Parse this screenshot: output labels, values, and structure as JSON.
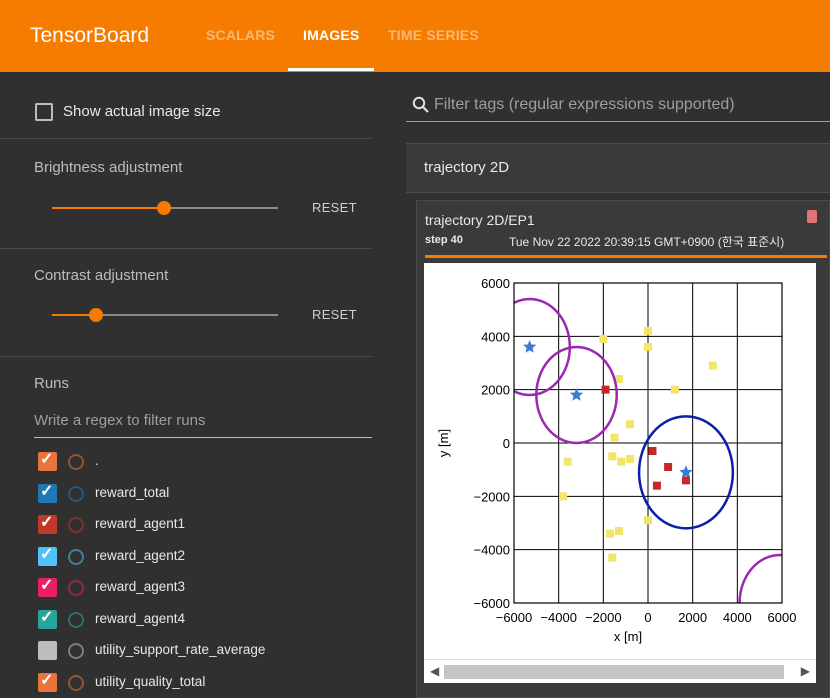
{
  "header": {
    "brand": "TensorBoard",
    "tabs": [
      {
        "label": "SCALARS",
        "active": false
      },
      {
        "label": "IMAGES",
        "active": true
      },
      {
        "label": "TIME SERIES",
        "active": false
      }
    ],
    "color": "#f57c00"
  },
  "sidebar": {
    "show_actual_size": {
      "label": "Show actual image size",
      "checked": false
    },
    "brightness": {
      "title": "Brightness adjustment",
      "reset_label": "RESET",
      "value": 0.5
    },
    "contrast": {
      "title": "Contrast adjustment",
      "reset_label": "RESET",
      "value": 0.2
    },
    "runs": {
      "title": "Runs",
      "filter_placeholder": "Write a regex to filter runs",
      "items": [
        {
          "label": ".",
          "checked": true,
          "color": "#e8743b"
        },
        {
          "label": "reward_total",
          "checked": true,
          "color": "#1f77b4"
        },
        {
          "label": "reward_agent1",
          "checked": true,
          "color": "#c0392b"
        },
        {
          "label": "reward_agent2",
          "checked": true,
          "color": "#4fc3f7"
        },
        {
          "label": "reward_agent3",
          "checked": true,
          "color": "#e91e63"
        },
        {
          "label": "reward_agent4",
          "checked": true,
          "color": "#26a69a"
        },
        {
          "label": "utility_support_rate_average",
          "checked": false,
          "color": "#bdbdbd"
        },
        {
          "label": "utility_quality_total",
          "checked": true,
          "color": "#e8743b"
        }
      ]
    }
  },
  "main": {
    "filter_placeholder": "Filter tags (regular expressions supported)",
    "group_title": "trajectory 2D",
    "card": {
      "title": "trajectory 2D/EP1",
      "step": "step 40",
      "timestamp": "Tue Nov 22 2022 20:39:15 GMT+0900 (한국 표준시)"
    }
  },
  "chart_data": {
    "type": "scatter",
    "xlabel": "x [m]",
    "ylabel": "y [m]",
    "xlim": [
      -6000,
      6000
    ],
    "ylim": [
      -6000,
      6000
    ],
    "x_ticks": [
      "−6000",
      "−4000",
      "−2000",
      "0",
      "2000",
      "4000",
      "6000"
    ],
    "y_ticks": [
      "6000",
      "4000",
      "2000",
      "0",
      "−2000",
      "−4000",
      "−6000"
    ],
    "grid": true,
    "stars": [
      {
        "x": -5300,
        "y": 3600
      },
      {
        "x": -3200,
        "y": 1800
      },
      {
        "x": 1700,
        "y": -1100
      }
    ],
    "circles": [
      {
        "x": -5300,
        "y": 3600,
        "r": 1800,
        "color": "#9c27b0"
      },
      {
        "x": -3200,
        "y": 1800,
        "r": 1800,
        "color": "#9c27b0"
      },
      {
        "x": 1700,
        "y": -1100,
        "r": 2100,
        "color": "#0d1fa8"
      },
      {
        "x": 5900,
        "y": -6000,
        "r": 1800,
        "color": "#9c27b0"
      }
    ],
    "red_squares": [
      {
        "x": -1900,
        "y": 2000
      },
      {
        "x": 200,
        "y": -300
      },
      {
        "x": 900,
        "y": -900
      },
      {
        "x": 400,
        "y": -1600
      },
      {
        "x": 1700,
        "y": -1400
      }
    ],
    "yellow_squares": [
      {
        "x": -2000,
        "y": 3900
      },
      {
        "x": 0,
        "y": 4200
      },
      {
        "x": 0,
        "y": 3600
      },
      {
        "x": -1300,
        "y": 2400
      },
      {
        "x": 1200,
        "y": 2000
      },
      {
        "x": 2900,
        "y": 2900
      },
      {
        "x": -800,
        "y": 700
      },
      {
        "x": -1500,
        "y": 200
      },
      {
        "x": -1600,
        "y": -500
      },
      {
        "x": -1200,
        "y": -700
      },
      {
        "x": -800,
        "y": -600
      },
      {
        "x": -3600,
        "y": -700
      },
      {
        "x": -3800,
        "y": -2000
      },
      {
        "x": -1300,
        "y": -3300
      },
      {
        "x": -1700,
        "y": -3400
      },
      {
        "x": 0,
        "y": -2900
      },
      {
        "x": -1600,
        "y": -4300
      }
    ]
  }
}
